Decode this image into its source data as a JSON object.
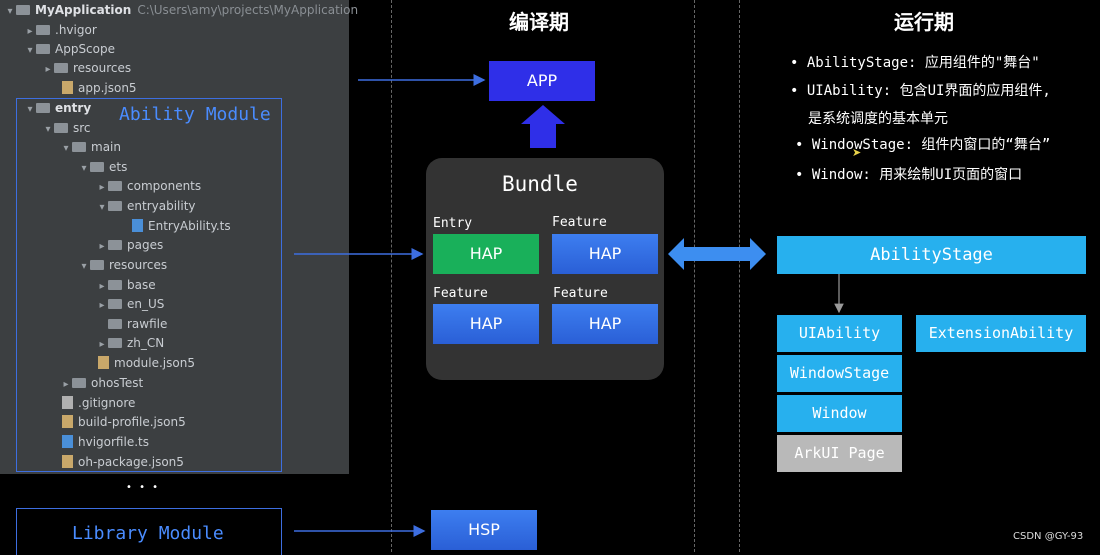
{
  "tree": {
    "root": {
      "label": "MyApplication",
      "path": "C:\\Users\\amy\\projects\\MyApplication"
    },
    "items": [
      {
        "label": ".hvigor"
      },
      {
        "label": "AppScope"
      },
      {
        "label": "resources"
      },
      {
        "label": "app.json5"
      },
      {
        "label": "entry"
      },
      {
        "label": "src"
      },
      {
        "label": "main"
      },
      {
        "label": "ets"
      },
      {
        "label": "components"
      },
      {
        "label": "entryability"
      },
      {
        "label": "EntryAbility.ts"
      },
      {
        "label": "pages"
      },
      {
        "label": "resources"
      },
      {
        "label": "base"
      },
      {
        "label": "en_US"
      },
      {
        "label": "rawfile"
      },
      {
        "label": "zh_CN"
      },
      {
        "label": "module.json5"
      },
      {
        "label": "ohosTest"
      },
      {
        "label": ".gitignore"
      },
      {
        "label": "build-profile.json5"
      },
      {
        "label": "hvigorfile.ts"
      },
      {
        "label": "oh-package.json5"
      }
    ]
  },
  "ability_module_label": "Ability Module",
  "library_module_label": "Library Module",
  "ellipsis": "• • •",
  "compile": {
    "title": "编译期",
    "app": "APP",
    "bundle_title": "Bundle",
    "entry_label": "Entry",
    "feature_label_1": "Feature",
    "feature_label_2": "Feature",
    "feature_label_3": "Feature",
    "hap": "HAP",
    "hsp": "HSP"
  },
  "runtime": {
    "title": "运行期",
    "bullets": [
      "AbilityStage: 应用组件的\"舞台\"",
      "UIAbility: 包含UI界面的应用组件,",
      "是系统调度的基本单元",
      "WindowStage: 组件内窗口的“舞台”",
      "Window: 用来绘制UI页面的窗口"
    ],
    "ability_stage": "AbilityStage",
    "ui_ability": "UIAbility",
    "extension_ability": "ExtensionAbility",
    "window_stage": "WindowStage",
    "window": "Window",
    "arkui_page": "ArkUI Page"
  },
  "colors": {
    "blue": "#2f6be3",
    "cyan": "#27b0ee",
    "green": "#19b05a",
    "grey": "#b9b9b9",
    "app": "#2f2fe8"
  },
  "watermark": "CSDN @GY-93"
}
